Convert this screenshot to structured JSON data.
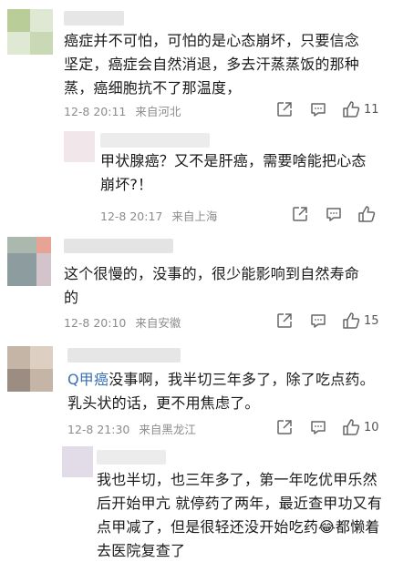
{
  "comments": [
    {
      "text": "癌症并不可怕，可怕的是心态崩坏，只要信念坚定，癌症会自然消退，多去汗蒸蒸饭的那种蒸，癌细胞抗不了那温度，",
      "time": "12-8 20:11",
      "location": "来自河北",
      "likes": "11",
      "avatar_colors": [
        "#c7d8b0",
        "#a8c48a",
        "#e8ecdf"
      ]
    },
    {
      "text": "甲状腺癌？又不是肝癌，需要啥能把心态崩坏?！",
      "time": "12-8 20:17",
      "location": "来自上海",
      "likes": "",
      "avatar_colors": [
        "#efe0e4",
        "#f3eaec"
      ]
    },
    {
      "text": "这个很慢的，没事的，很少能影响到自然寿命的",
      "time": "12-8 20:10",
      "location": "来自安徽",
      "likes": "15",
      "avatar_colors": [
        "#9bb0a3",
        "#d98e84",
        "#b7a7ad",
        "#7f8e96"
      ]
    },
    {
      "topic": "Q甲癌",
      "text": "没事啊，我半切三年多了，除了吃点药。乳头状的话，更不用焦虑了。",
      "time": "12-8 21:30",
      "location": "来自黑龙江",
      "likes": "10",
      "avatar_colors": [
        "#b8a99a",
        "#d9cbbb",
        "#8e7f74"
      ]
    },
    {
      "text": "我也半切，也三年多了，第一年吃优甲乐然后开始甲亢 就停药了两年，最近查甲功又有点甲减了，但是很轻还没开始吃药😂都懒着去医院复查了",
      "avatar_colors": [
        "#ded8e4",
        "#e9e5ee"
      ]
    }
  ],
  "icons": [
    "share-icon",
    "comment-icon",
    "like-icon"
  ]
}
